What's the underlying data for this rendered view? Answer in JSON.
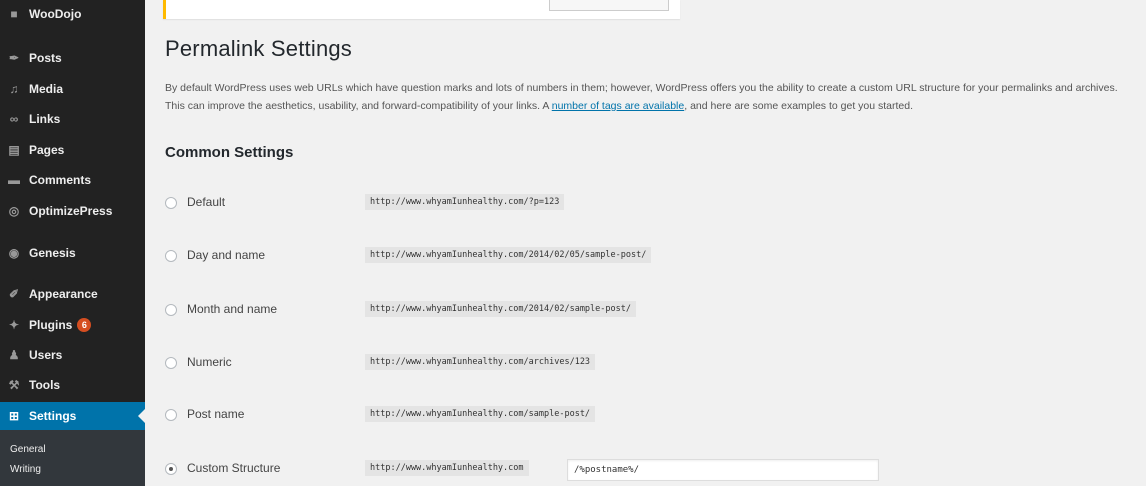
{
  "sidebar": {
    "items": [
      {
        "label": "WooDojo",
        "icon": "woodojo-icon",
        "glyph": "■"
      },
      {
        "label": "Posts",
        "icon": "pushpin-icon",
        "glyph": "✒"
      },
      {
        "label": "Media",
        "icon": "media-icon",
        "glyph": "♫"
      },
      {
        "label": "Links",
        "icon": "link-icon",
        "glyph": "∞"
      },
      {
        "label": "Pages",
        "icon": "pages-icon",
        "glyph": "▤"
      },
      {
        "label": "Comments",
        "icon": "comment-icon",
        "glyph": "▬"
      },
      {
        "label": "OptimizePress",
        "icon": "optimizepress-icon",
        "glyph": "◎"
      },
      {
        "label": "Genesis",
        "icon": "genesis-icon",
        "glyph": "◉"
      },
      {
        "label": "Appearance",
        "icon": "brush-icon",
        "glyph": "✐"
      },
      {
        "label": "Plugins",
        "icon": "plug-icon",
        "glyph": "✦",
        "badge": "6"
      },
      {
        "label": "Users",
        "icon": "user-icon",
        "glyph": "♟"
      },
      {
        "label": "Tools",
        "icon": "wrench-icon",
        "glyph": "⚒"
      },
      {
        "label": "Settings",
        "icon": "settings-icon",
        "glyph": "⊞",
        "active": true
      }
    ],
    "submenu": [
      "General",
      "Writing"
    ]
  },
  "page": {
    "title": "Permalink Settings",
    "intro_before": "By default WordPress uses web URLs which have question marks and lots of numbers in them; however, WordPress offers you the ability to create a custom URL structure for your permalinks and archives. This can improve the aesthetics, usability, and forward-compatibility of your links. A ",
    "intro_link": "number of tags are available",
    "intro_after": ", and here are some examples to get you started.",
    "section_title": "Common Settings"
  },
  "options": [
    {
      "label": "Default",
      "url": "http://www.whyamIunhealthy.com/?p=123",
      "checked": false
    },
    {
      "label": "Day and name",
      "url": "http://www.whyamIunhealthy.com/2014/02/05/sample-post/",
      "checked": false
    },
    {
      "label": "Month and name",
      "url": "http://www.whyamIunhealthy.com/2014/02/sample-post/",
      "checked": false
    },
    {
      "label": "Numeric",
      "url": "http://www.whyamIunhealthy.com/archives/123",
      "checked": false
    },
    {
      "label": "Post name",
      "url": "http://www.whyamIunhealthy.com/sample-post/",
      "checked": false
    },
    {
      "label": "Custom Structure",
      "url": "http://www.whyamIunhealthy.com",
      "checked": true
    }
  ],
  "custom_structure_value": "/%postname%/",
  "colors": {
    "sidebar_bg": "#222222",
    "active_bg": "#0073aa",
    "badge": "#d54e21",
    "notice_border": "#ffba00",
    "link": "#0073aa"
  }
}
